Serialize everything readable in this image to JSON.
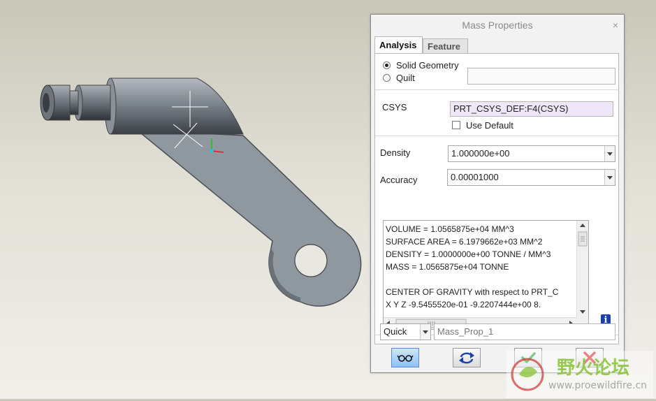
{
  "dialog": {
    "title": "Mass Properties",
    "close_label": "×",
    "tabs": [
      {
        "label": "Analysis",
        "active": true
      },
      {
        "label": "Feature",
        "active": false
      }
    ],
    "geometry": {
      "options": [
        {
          "label": "Solid Geometry",
          "selected": true
        },
        {
          "label": "Quilt",
          "selected": false
        }
      ],
      "quilt_value": ""
    },
    "csys": {
      "label": "CSYS",
      "value": "PRT_CSYS_DEF:F4(CSYS)",
      "use_default_label": "Use Default",
      "use_default_checked": false
    },
    "density": {
      "label": "Density",
      "value": "1.000000e+00"
    },
    "accuracy": {
      "label": "Accuracy",
      "value": "0.00001000"
    },
    "results": [
      "VOLUME =  1.0565875e+04  MM^3",
      "SURFACE AREA =  6.1979662e+03  MM^2",
      "DENSITY =  1.0000000e+00 TONNE / MM^3",
      "MASS =  1.0565875e+04 TONNE",
      "",
      "CENTER OF GRAVITY with respect to PRT_C",
      "X   Y   Z     -9.5455520e-01 -9.2207444e+00  8."
    ],
    "info_icon": "info-icon",
    "analysis_type": {
      "value": "Quick"
    },
    "analysis_name": {
      "value": "Mass_Prop_1"
    },
    "buttons": [
      {
        "name": "preview",
        "icon": "glasses-icon"
      },
      {
        "name": "repeat",
        "icon": "repeat-icon"
      },
      {
        "name": "ok",
        "icon": "check-icon"
      },
      {
        "name": "cancel",
        "icon": "x-icon"
      }
    ]
  },
  "watermark": {
    "title": "野火论坛",
    "url": "www.proewildfire.cn"
  },
  "colors": {
    "dialog_bg": "#f2f2f2",
    "csys_highlight": "#efe6f7",
    "part_gray": "#8c949c",
    "watermark_green": "#8cc63e"
  }
}
